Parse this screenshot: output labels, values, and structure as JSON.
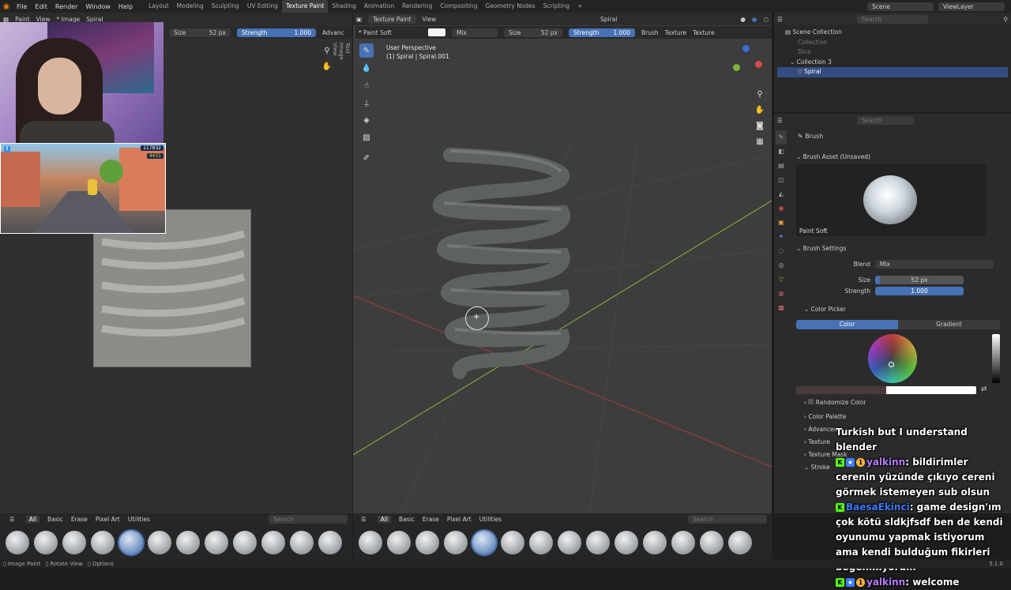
{
  "menu": [
    "File",
    "Edit",
    "Render",
    "Window",
    "Help"
  ],
  "workspaces": [
    "Layout",
    "Modeling",
    "Sculpting",
    "UV Editing",
    "Texture Paint",
    "Shading",
    "Animation",
    "Rendering",
    "Compositing",
    "Geometry Nodes",
    "Scripting"
  ],
  "scene": "Scene",
  "view_layer": "ViewLayer",
  "image_editor": {
    "mode": "Paint",
    "view": "View",
    "image": "* Image",
    "object": "Spiral",
    "size_label": "Size",
    "size_value": "52 px",
    "strength_label": "Strength",
    "strength_value": "1.000",
    "advanced": "Advanc",
    "side_tabs": [
      "Tool",
      "Image",
      "View"
    ]
  },
  "viewport": {
    "mode": "Texture Paint",
    "view": "View",
    "brush": "* Paint Soft",
    "blend": "Mix",
    "size_label": "Size",
    "size_value": "52 px",
    "strength_label": "Strength",
    "strength_value": "1.000",
    "brush_menu": "Brush",
    "texture_menu": "Texture",
    "texture_menu2": "Texture",
    "object_selector": "Spiral",
    "perspective": "User Perspective",
    "object_info": "(1) Spiral | Spiral.001"
  },
  "outliner": {
    "search_placeholder": "Search",
    "root": "Scene Collection",
    "items": [
      "Collection",
      "Dice",
      "Collection 3",
      "Spiral"
    ]
  },
  "properties": {
    "search_placeholder": "Search",
    "panel_title": "Brush",
    "brush_asset": "Brush Asset (Unsaved)",
    "brush_name": "Paint Soft",
    "brush_settings": "Brush Settings",
    "blend_label": "Blend",
    "blend_value": "Mix",
    "size_label": "Size",
    "size_value": "52 px",
    "strength_label": "Strength",
    "strength_value": "1.000",
    "color_picker": "Color Picker",
    "color_tab": "Color",
    "gradient_tab": "Gradient",
    "randomize": "Randomize Color",
    "color_palette": "Color Palette",
    "advanced": "Advanced",
    "texture": "Texture",
    "texture_mask": "Texture Mask",
    "stroke": "Stroke"
  },
  "asset_shelf": {
    "tabs": [
      "All",
      "Basic",
      "Erase",
      "Pixel Art",
      "Utilities"
    ],
    "search_placeholder": "Search"
  },
  "statusbar": {
    "hints": [
      "Image Paint",
      "Rotate View",
      "Options"
    ],
    "version": "5.1.0"
  },
  "game_hud": {
    "score": "117832",
    "coins": "4431"
  },
  "chat": [
    {
      "user": "",
      "text": "Turkish but I understand blender"
    },
    {
      "user": "yalkinn",
      "text": ": bildirimler cerenin yüzünde çıkıyo cereni görmek istemeyen sub olsun"
    },
    {
      "user": "BaesaEkinci",
      "text": ": game design'ım çok kötü sldkjfsdf ben de kendi oyunumu yapmak istiyorum ama kendi bulduğum fikirleri beğenmiyorum"
    },
    {
      "user": "yalkinn",
      "text": ": welcome"
    }
  ],
  "colors": {
    "accent": "#4772b3",
    "header": "#2c2c2c",
    "viewport_bg": "#3d3d3d",
    "chat_user_purple": "#b77cff",
    "chat_user_blue": "#3b7bff"
  }
}
